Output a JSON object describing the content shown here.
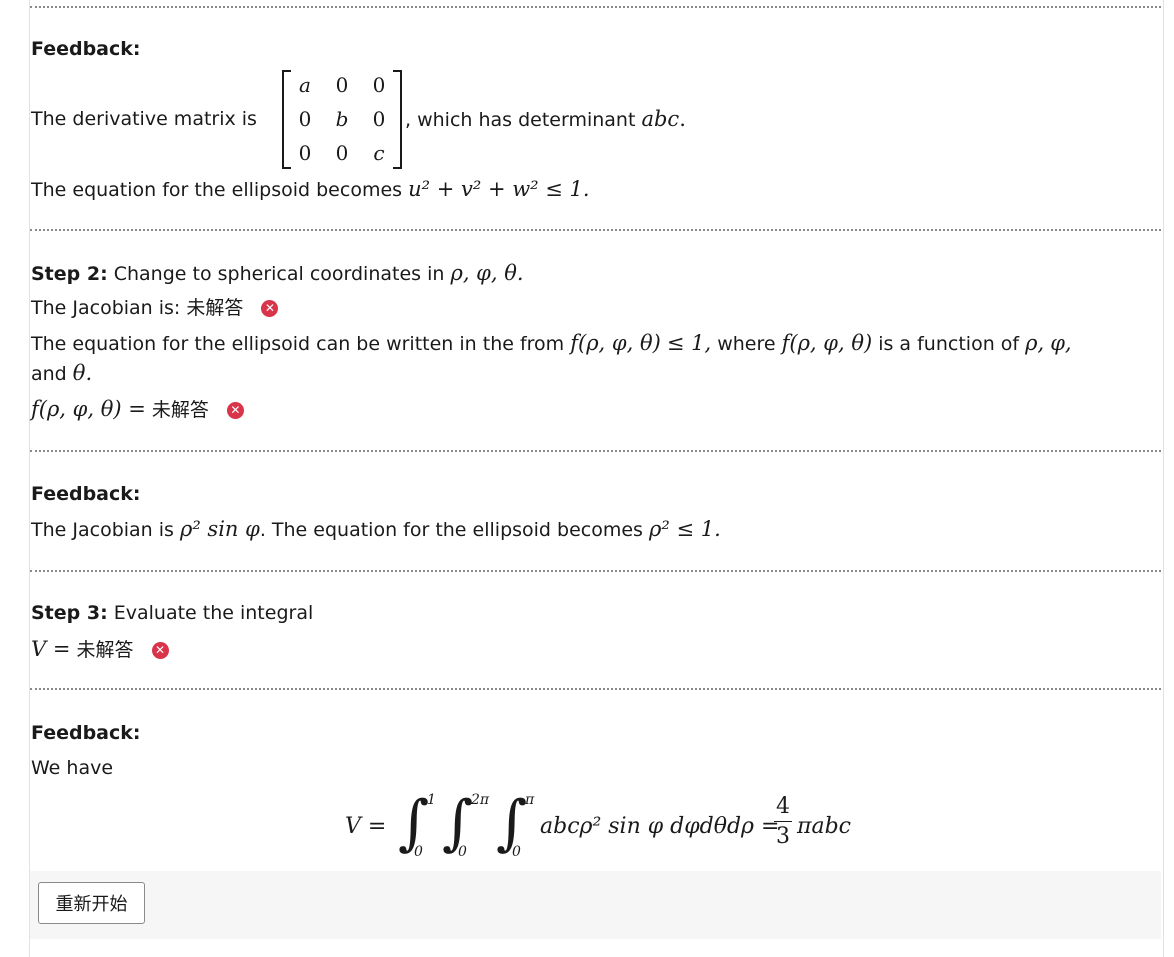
{
  "feedback1": {
    "heading": "Feedback:",
    "derivative_prefix": "The derivative matrix is",
    "derivative_suffix": ", which has determinant",
    "determinant": "abc",
    "matrix": [
      [
        "a",
        "0",
        "0"
      ],
      [
        "0",
        "b",
        "0"
      ],
      [
        "0",
        "0",
        "c"
      ]
    ],
    "ellipsoid_prefix": "The equation for the ellipsoid becomes",
    "ellipsoid_math": "u² + v² + w² ≤ 1."
  },
  "step2": {
    "label": "Step 2:",
    "instruction": "Change to spherical coordinates in",
    "vars": "ρ, φ, θ.",
    "jacobian_label": "The Jacobian is:",
    "unanswered": "未解答",
    "equation_text_1": "The equation for the ellipsoid can be written in the from",
    "f_expr": "f(ρ, φ, θ)",
    "le_one": "≤ 1,",
    "equation_text_2": "where",
    "equation_text_3": "is a function of",
    "rho": "ρ,",
    "phi": "φ,",
    "and_text": "and",
    "theta": "θ.",
    "f_eq": "f(ρ, φ, θ) ="
  },
  "feedback2": {
    "heading": "Feedback:",
    "text1": "The Jacobian is",
    "jacobian_math": "ρ² sin φ",
    "text2": ". The equation for the ellipsoid becomes",
    "ellipsoid_math": "ρ² ≤ 1."
  },
  "step3": {
    "label": "Step 3:",
    "instruction": "Evaluate the integral",
    "v_eq": "V ="
  },
  "feedback3": {
    "heading": "Feedback:",
    "text": "We have",
    "v_lhs": "V =",
    "lim1_upper": "1",
    "lim2_upper": "2π",
    "lim3_upper": "π",
    "lim_lower": "0",
    "integrand": "abcρ² sin φ dφdθdρ =",
    "frac_num": "4",
    "frac_den": "3",
    "result": "πabc"
  },
  "footer": {
    "restart_label": "重新开始"
  },
  "colors": {
    "error": "#d9344a",
    "divider": "#8a8a8a",
    "footer_bg": "#f6f6f6"
  }
}
